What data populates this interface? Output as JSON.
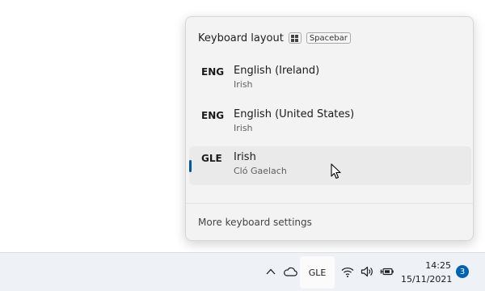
{
  "flyout": {
    "title": "Keyboard layout",
    "shortcut_key": "Spacebar",
    "layouts": [
      {
        "code": "ENG",
        "name": "English (Ireland)",
        "keyboard": "Irish",
        "selected": false
      },
      {
        "code": "ENG",
        "name": "English (United States)",
        "keyboard": "Irish",
        "selected": false
      },
      {
        "code": "GLE",
        "name": "Irish",
        "keyboard": "Cló Gaelach",
        "selected": true
      }
    ],
    "more_settings": "More keyboard settings"
  },
  "taskbar": {
    "language": "GLE",
    "time": "14:25",
    "date": "15/11/2021",
    "notification_count": "3",
    "icons": [
      "chevron-up-icon",
      "onedrive-cloud-icon",
      "wifi-icon",
      "speaker-icon",
      "battery-plug-icon"
    ]
  },
  "colors": {
    "accent": "#005a9e",
    "badge": "#0063b1",
    "flyout_bg": "#f3f3f3",
    "selected_bg": "#eaeaea",
    "taskbar_bg": "#eef1f6"
  }
}
